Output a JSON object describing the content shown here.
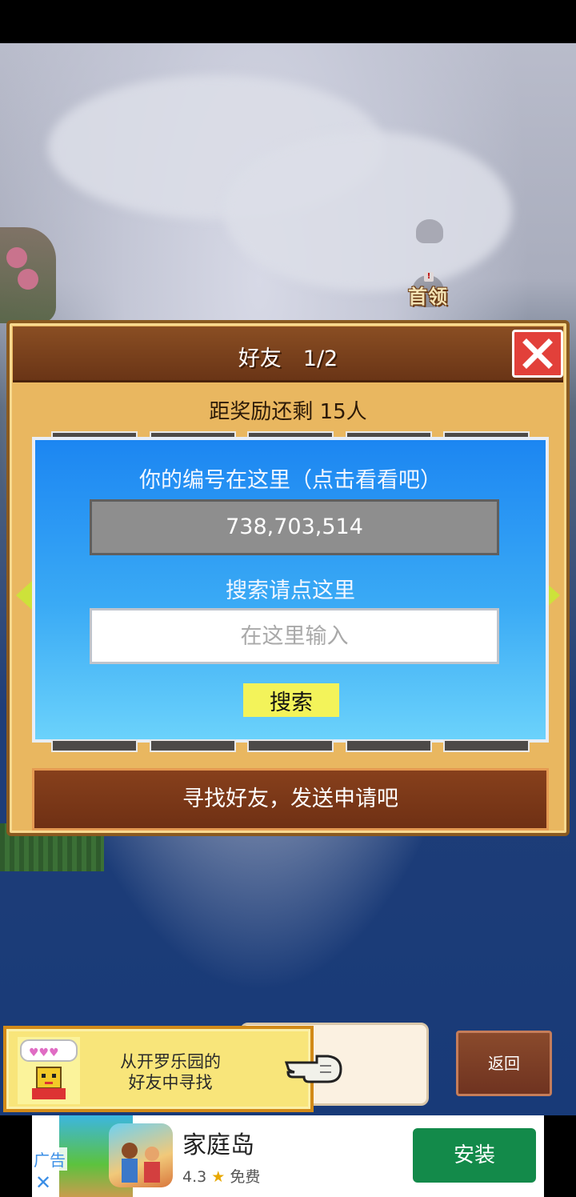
{
  "map": {
    "boss_label": "首领"
  },
  "dialog": {
    "title": "好友　1/2",
    "reward_remaining": "距奖励还剩 15人",
    "id_prompt": "你的编号在这里（点击看看吧）",
    "player_id": "738,703,514",
    "search_prompt": "搜索请点这里",
    "search_placeholder": "在这里输入",
    "search_button": "搜索",
    "find_friends_button": "寻找好友，发送申请吧"
  },
  "kairo_link": {
    "text_line1": "从开罗乐园的",
    "text_line2": "好友中寻找"
  },
  "back_button": "返回",
  "ad": {
    "label": "广告",
    "close": "✕",
    "app_name": "家庭岛",
    "rating": "4.3",
    "star": "★",
    "price": "免费",
    "install_button": "安装"
  },
  "colors": {
    "panel_blue": "#1c86f2",
    "dialog_frame": "#e9b760",
    "close_red": "#e2403a",
    "search_yellow": "#f3f35a",
    "install_green": "#138a4a"
  }
}
